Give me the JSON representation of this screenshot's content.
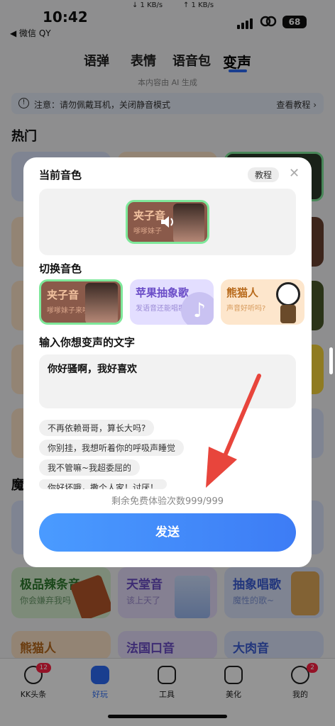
{
  "status": {
    "time": "10:42",
    "back_label": "◀ 微信 QY",
    "down_speed": "↓ 1 KB/s",
    "up_speed": "↑ 1 KB/s",
    "battery": "68"
  },
  "tabs": [
    "语弹",
    "表情",
    "语音包",
    "变声"
  ],
  "ai_note": "本内容由 AI 生成",
  "notice": {
    "text": "注意：请勿佩戴耳机，关闭静音模式",
    "more": "查看教程 ›"
  },
  "sections": {
    "hot": "热门",
    "magic": "魔"
  },
  "bg_cards": [
    {
      "title": "极品辣条音",
      "subtitle": "你会嫌弃我吗",
      "color": "#d7f0d0"
    },
    {
      "title": "天堂音",
      "subtitle": "该上天了",
      "color": "#e5ddfb"
    },
    {
      "title": "抽象唱歌",
      "subtitle": "魔性的歌~",
      "color": "#dbe4fb"
    },
    {
      "title": "熊猫人",
      "subtitle": "",
      "color": "#fde3c8"
    },
    {
      "title": "法国口音",
      "subtitle": "",
      "color": "#e5ddfb"
    },
    {
      "title": "大肉音",
      "subtitle": "",
      "color": "#dbe4fb"
    }
  ],
  "modal": {
    "title": "当前音色",
    "tutorial": "教程",
    "close": "✕",
    "current_voice": {
      "title": "夹子音",
      "subtitle": "嗲嗲妹子"
    },
    "switch_title": "切换音色",
    "voices": [
      {
        "title": "夹子音",
        "subtitle": "嗲嗲妹子来啦",
        "selected": true,
        "color": "#8a5a4a"
      },
      {
        "title": "苹果抽象歌",
        "subtitle": "发语音还能唱歌?",
        "selected": false,
        "color": "#e3deff"
      },
      {
        "title": "熊猫人",
        "subtitle": "声音好听吗?",
        "selected": false,
        "color": "#fde6cc"
      }
    ],
    "input_title": "输入你想变声的文字",
    "input_value": "你好骚啊，我好喜欢",
    "suggestions": [
      "不再依赖哥哥，算长大吗?",
      "你别挂，我想听着你的呼吸声睡觉",
      "我不管嘛~我超委屈的",
      "你好坏哦，撒个人家！讨厌！"
    ],
    "remaining": "剩余免费体验次数999/999",
    "send": "发送"
  },
  "nav": [
    {
      "label": "KK头条",
      "badge": "12"
    },
    {
      "label": "好玩",
      "badge": ""
    },
    {
      "label": "工具",
      "badge": ""
    },
    {
      "label": "美化",
      "badge": ""
    },
    {
      "label": "我的",
      "badge": "2"
    }
  ],
  "colors": {
    "accent": "#2b6cf6",
    "arrow": "#e8453c",
    "selected_border": "#7ee89a"
  }
}
